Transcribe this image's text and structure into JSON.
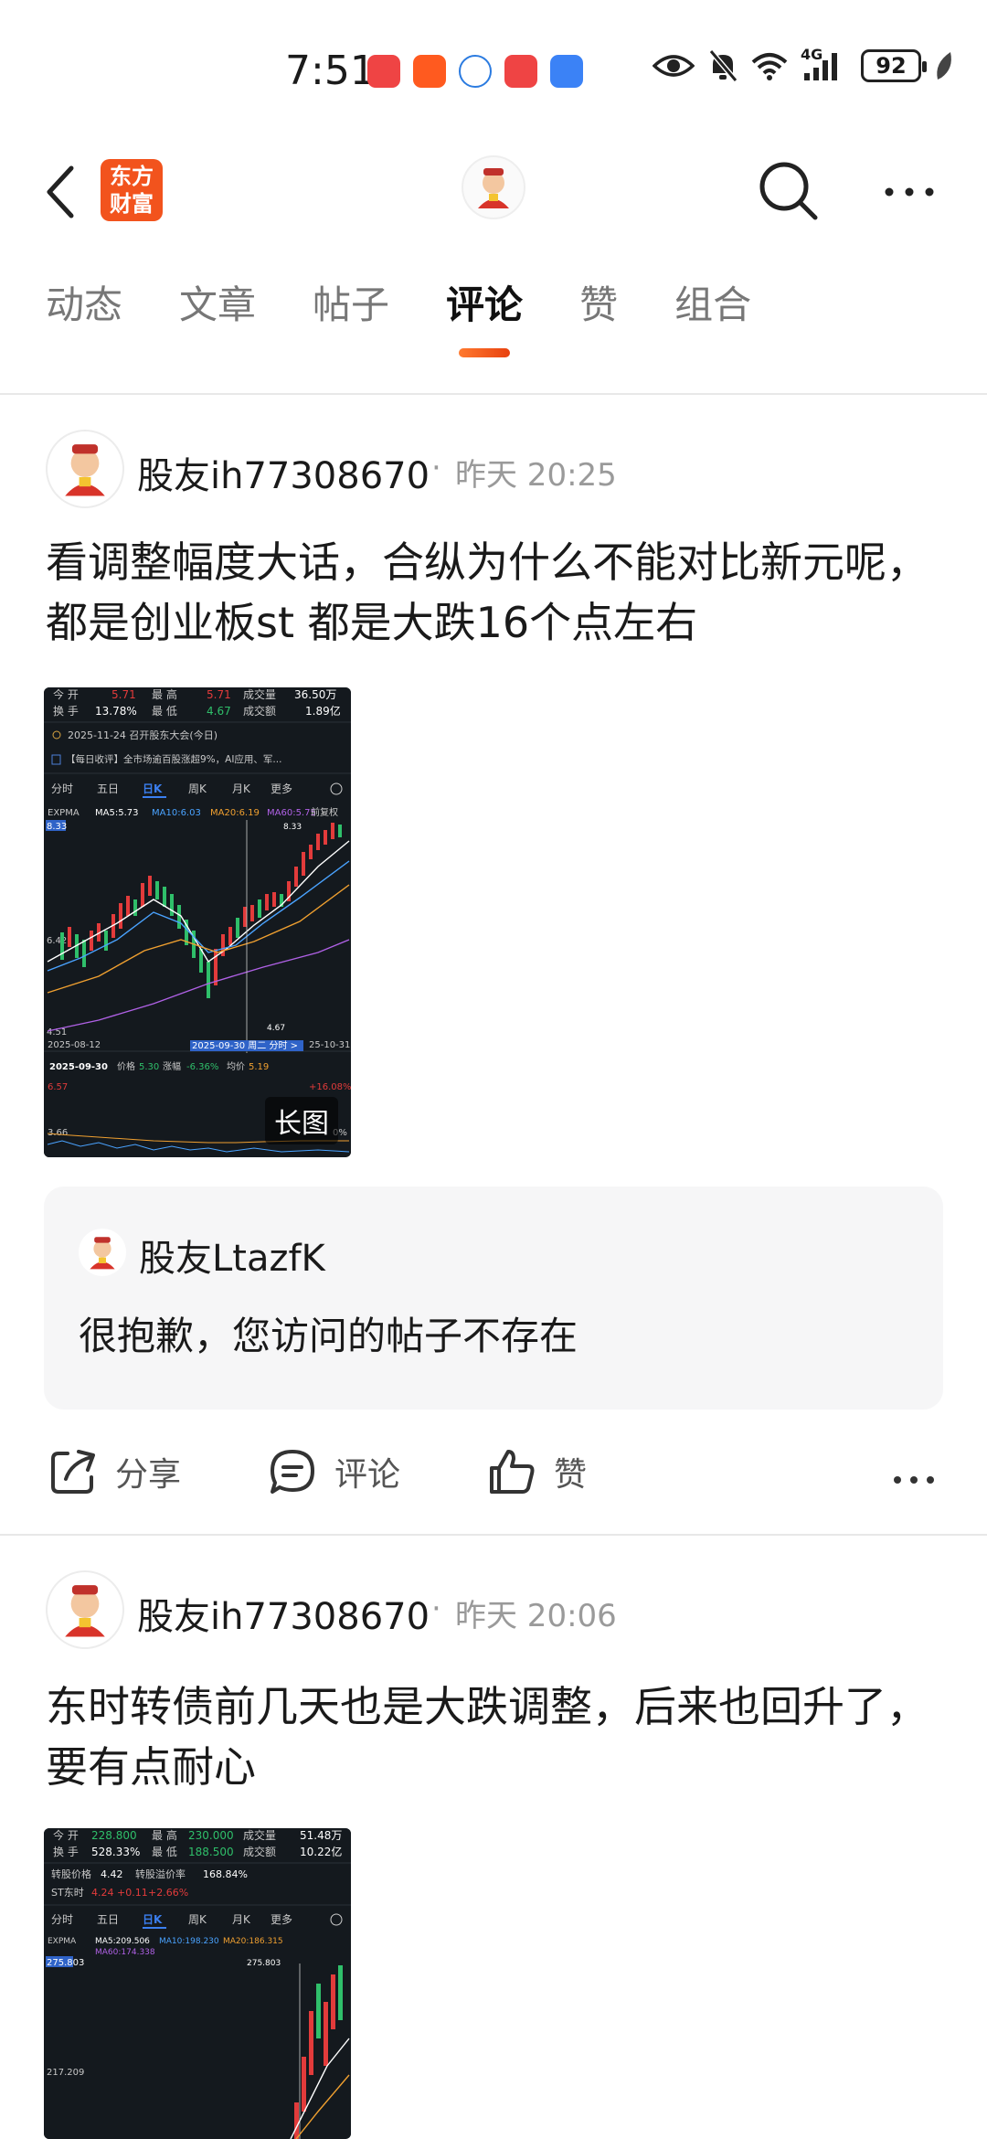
{
  "status_bar": {
    "time": "7:51",
    "battery": "92",
    "network": "4G"
  },
  "header": {
    "app_logo_text": "东方财富"
  },
  "tabs": [
    {
      "label": "动态"
    },
    {
      "label": "文章"
    },
    {
      "label": "帖子"
    },
    {
      "label": "评论",
      "active": true
    },
    {
      "label": "赞"
    },
    {
      "label": "组合"
    }
  ],
  "posts": [
    {
      "username": "股友ih77308670",
      "dot": "·",
      "time": "昨天 20:25",
      "content": "看调整幅度大话，合纵为什么不能对比新元呢，都是创业板st 都是大跌16个点左右",
      "image_badge": "长图",
      "chart": {
        "header": {
          "open_label": "今 开",
          "open": "5.71",
          "high_label": "最 高",
          "high": "5.71",
          "vol_label": "成交量",
          "vol": "36.50万",
          "turnover_label": "换 手",
          "turnover": "13.78%",
          "low_label": "最 低",
          "low": "4.67",
          "amount_label": "成交额",
          "amount": "1.89亿"
        },
        "notice": "2025-11-24 召开股东大会(今日)",
        "news": "【每日收评】全市场逾百股涨超9%，AI应用、军...",
        "periods": [
          "分时",
          "五日",
          "日K",
          "周K",
          "月K",
          "更多"
        ],
        "ma": {
          "ema": "EXPMA",
          "ma5": "MA5:5.73",
          "ma10": "MA10:6.03",
          "ma20": "MA20:6.19",
          "ma60": "MA60:5.75",
          "adj": "前复权"
        },
        "y_top": "8.33",
        "y_mid": "6.42",
        "y_low": "4.51",
        "max_label": "8.33",
        "min_label": "4.67",
        "x_start": "2025-08-12",
        "x_sel": "2025-09-30 周二 分时 >",
        "x_end": "25-10-31",
        "sub": {
          "date": "2025-09-30",
          "price_label": "价格",
          "price": "5.30",
          "chg_label": "涨幅",
          "chg": "-6.36%",
          "avg_label": "均价",
          "avg": "5.19",
          "hi": "6.57",
          "hi_pct": "+16.08%",
          "lo": "3.66",
          "lo_pct": "0%"
        }
      },
      "quote": {
        "username": "股友LtazfK",
        "text": "很抱歉，您访问的帖子不存在"
      },
      "actions": {
        "share": "分享",
        "comment": "评论",
        "like": "赞"
      }
    },
    {
      "username": "股友ih77308670",
      "dot": "·",
      "time": "昨天 20:06",
      "content": "东时转债前几天也是大跌调整，后来也回升了，要有点耐心",
      "chart": {
        "header": {
          "open_label": "今 开",
          "open": "228.800",
          "high_label": "最 高",
          "high": "230.000",
          "vol_label": "成交量",
          "vol": "51.48万",
          "turnover_label": "换 手",
          "turnover": "528.33%",
          "low_label": "最 低",
          "low": "188.500",
          "amount_label": "成交额",
          "amount": "10.22亿"
        },
        "conv_price_label": "转股价格",
        "conv_price": "4.42",
        "premium_label": "转股溢价率",
        "premium": "168.84%",
        "stock_name": "ST东时",
        "stock_price": "4.24",
        "stock_chg": "+0.11",
        "stock_pct": "+2.66%",
        "periods": [
          "分时",
          "五日",
          "日K",
          "周K",
          "月K",
          "更多"
        ],
        "ma": {
          "ema": "EXPMA",
          "ma5": "MA5:209.506",
          "ma10": "MA10:198.230",
          "ma20": "MA20:186.315",
          "ma60": "MA60:174.338"
        },
        "y_top": "275.803",
        "y_mid": "217.209",
        "max_label": "275.803"
      }
    }
  ]
}
